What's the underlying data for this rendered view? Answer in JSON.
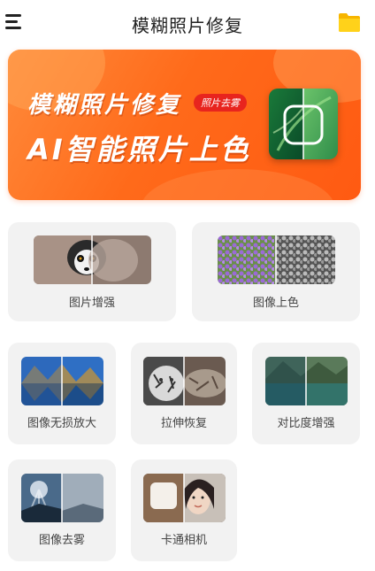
{
  "app": {
    "title": "模糊照片修复",
    "menu_icon": "hamburger-menu-icon",
    "folder_icon": "folder-icon",
    "accent_color": "#ff6a1a"
  },
  "banner": {
    "line1": "模糊照片修复",
    "tag": "照片去雾",
    "line2": "AI智能照片上色"
  },
  "features": {
    "enhance": "图片增强",
    "colorize": "图像上色",
    "lossless_zoom": "图像无损放大",
    "stretch_restore": "拉伸恢复",
    "contrast_enhance": "对比度增强",
    "dehaze": "图像去雾",
    "cartoon_camera": "卡通相机"
  }
}
